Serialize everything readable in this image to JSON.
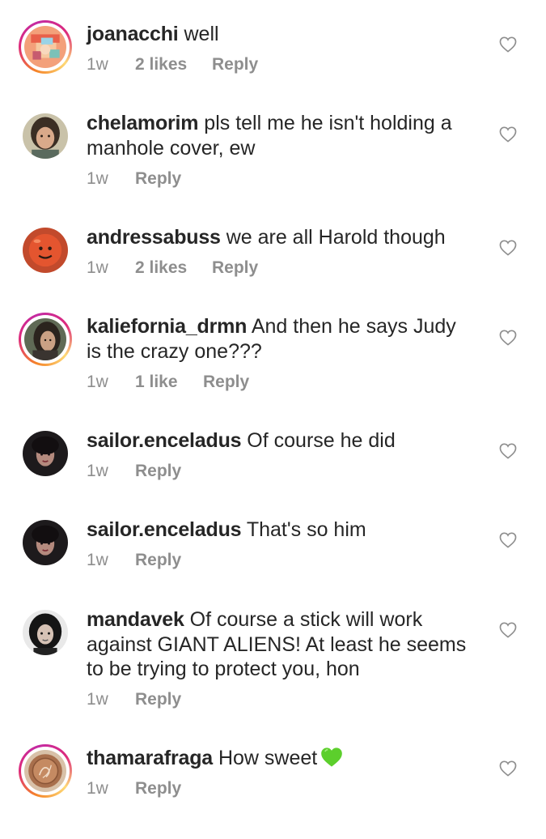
{
  "comments": [
    {
      "username": "joanacchi",
      "text": "well",
      "time": "1w",
      "likes": "2 likes",
      "reply": "Reply"
    },
    {
      "username": "chelamorim",
      "text": "pls tell me he isn't holding a manhole cover, ew",
      "time": "1w",
      "likes": "",
      "reply": "Reply"
    },
    {
      "username": "andressabuss",
      "text": "we are all Harold though",
      "time": "1w",
      "likes": "2 likes",
      "reply": "Reply"
    },
    {
      "username": "kaliefornia_drmn",
      "text": "And then he says Judy is the crazy one???",
      "time": "1w",
      "likes": "1 like",
      "reply": "Reply"
    },
    {
      "username": "sailor.enceladus",
      "text": "Of course he did",
      "time": "1w",
      "likes": "",
      "reply": "Reply"
    },
    {
      "username": "sailor.enceladus",
      "text": "That's so him",
      "time": "1w",
      "likes": "",
      "reply": "Reply"
    },
    {
      "username": "mandavek",
      "text": "Of course a stick will work against GIANT ALIENS! At least he seems to be trying to protect you, hon",
      "time": "1w",
      "likes": "",
      "reply": "Reply"
    },
    {
      "username": "thamarafraga",
      "text": "How sweet",
      "emoji": "green-heart",
      "time": "1w",
      "likes": "",
      "reply": "Reply"
    }
  ],
  "colors": {
    "text": "#262626",
    "meta": "#8e8e8e",
    "story_ring_start": "#f58529",
    "story_ring_end": "#dd2a7b",
    "green_heart": "#5ccf2c"
  },
  "icons": {
    "like": "heart-outline-icon",
    "emoji": "green-heart-emoji"
  }
}
